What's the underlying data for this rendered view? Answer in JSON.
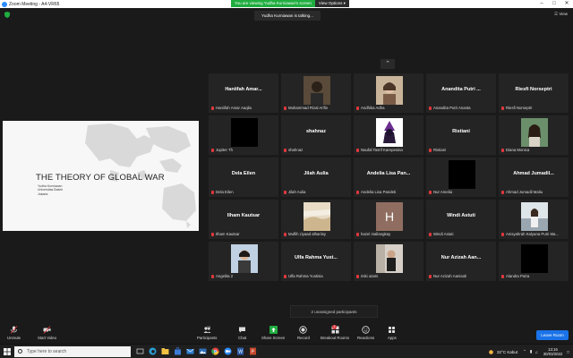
{
  "window": {
    "title": "Zoom Meeting - A4-VR65"
  },
  "banner": {
    "viewing_text": "You are viewing Yudha Kurniawan's screen",
    "options_label": "View Options ▾"
  },
  "top": {
    "view_label": "View"
  },
  "talking": {
    "text": "Yudha Kurniawan is talking..."
  },
  "slide": {
    "title": "THE THEORY OF GLOBAL WAR",
    "line1": "Yudha Kurniawan",
    "line2": "Universitas Bakrie",
    "line3": "Jakarta"
  },
  "gallery": {
    "scroll_up": "⌃",
    "tiles": [
      {
        "big": "Haniifah Amar...",
        "label": "Haniifah Amar Aaqila",
        "kind": "name"
      },
      {
        "big": "",
        "label": "Muhammad Rizal Arifin",
        "kind": "photo1"
      },
      {
        "big": "",
        "label": "Andhika Adha",
        "kind": "photo2"
      },
      {
        "big": "Anandita Putri ...",
        "label": "Anandita Putri Ananta",
        "kind": "name"
      },
      {
        "big": "Riesfi Norseptri",
        "label": "Riesfi Norseptri",
        "kind": "name"
      },
      {
        "big": "",
        "label": "Jupiter Th",
        "kind": "black"
      },
      {
        "big": "shahnaz",
        "label": "shahnaz",
        "kind": "name"
      },
      {
        "big": "",
        "label": "Naufal Tasrif Karepesina",
        "kind": "photo3"
      },
      {
        "big": "Ristiani",
        "label": "Ristiani",
        "kind": "name"
      },
      {
        "big": "",
        "label": "Diana Monica",
        "kind": "photo4"
      },
      {
        "big": "Dela Eilen",
        "label": "Dela Eilen",
        "kind": "name"
      },
      {
        "big": "Jilah Aulia",
        "label": "Jilah Aulia",
        "kind": "name"
      },
      {
        "big": "Andelia Lisa Pan...",
        "label": "Andelia Lisa Pandeti",
        "kind": "name"
      },
      {
        "big": "",
        "label": "Nur Amelia",
        "kind": "black"
      },
      {
        "big": "Ahmad Jumadil...",
        "label": "Ahmad Jumadil Maliu",
        "kind": "name"
      },
      {
        "big": "Ilham Kautsar",
        "label": "Ilham Kautsar",
        "kind": "name"
      },
      {
        "big": "",
        "label": "Muflih ziyaad alhariisy",
        "kind": "photo5"
      },
      {
        "big": "",
        "label": "hazel mallangkay",
        "kind": "letter",
        "letter": "H"
      },
      {
        "big": "Windi Astuti",
        "label": "Windi Astuti",
        "kind": "name"
      },
      {
        "big": "",
        "label": "Anisyahrah Kalyana Putri Ma...",
        "kind": "photo6"
      },
      {
        "big": "",
        "label": "Angelita 2",
        "kind": "photo7"
      },
      {
        "big": "Ulfa Rahma Yust...",
        "label": "Ulfa Rahma Yustisia",
        "kind": "name"
      },
      {
        "big": "",
        "label": "riski utami",
        "kind": "photo8"
      },
      {
        "big": "Nur Azizah Aan...",
        "label": "Nur Azizah Aanisah",
        "kind": "name"
      },
      {
        "big": "",
        "label": "Alandra Putra",
        "kind": "black"
      }
    ]
  },
  "unassigned": {
    "text": "2 unassigned participants"
  },
  "toolbar": {
    "unmute": "Unmute",
    "start_video": "Start Video",
    "participants": "Participants",
    "participants_count": "38",
    "chat": "Chat",
    "share_screen": "Share Screen",
    "record": "Record",
    "breakout_rooms": "Breakout Rooms",
    "breakout_badge": "2",
    "reactions": "Reactions",
    "apps": "Apps",
    "leave": "Leave Room"
  },
  "taskbar": {
    "search_placeholder": "Type here to search",
    "weather": "32°C  Kabut",
    "time": "13:16",
    "date": "30/03/2022"
  },
  "colors": {
    "accent_green": "#1fad3f",
    "leave_blue": "#1a73e8",
    "mute_red": "#e0383e"
  }
}
